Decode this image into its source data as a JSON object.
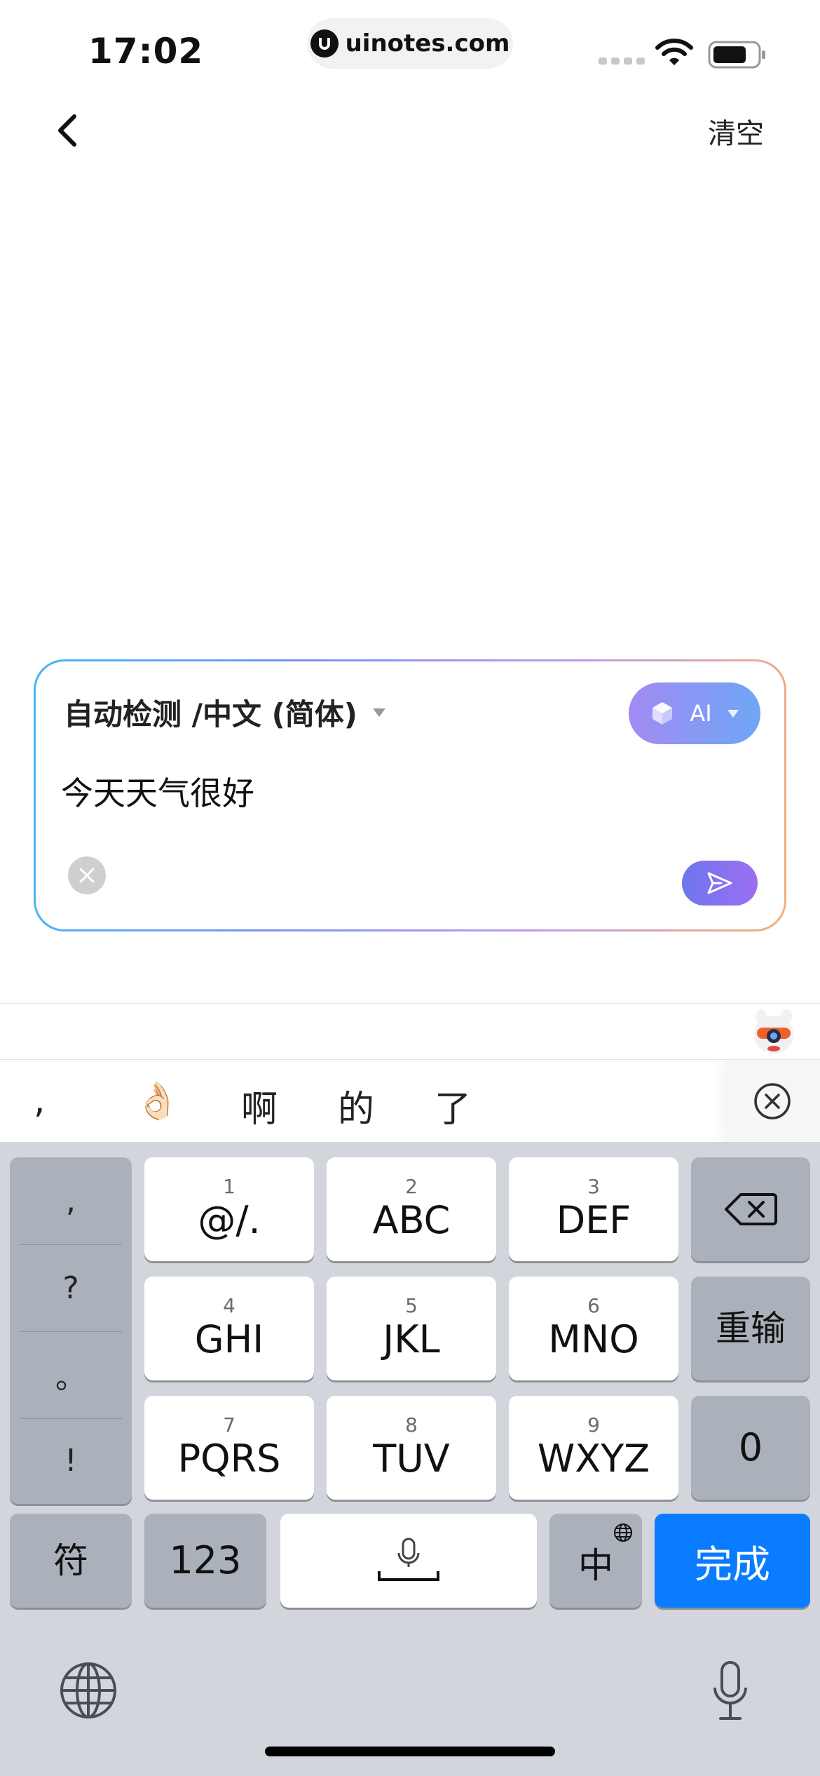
{
  "status_bar": {
    "time": "17:02",
    "url": "uinotes.com"
  },
  "header": {
    "clear_label": "清空"
  },
  "translator": {
    "language_label": "自动检测 /中文 (简体)",
    "ai_label": "AI",
    "input_text": "今天天气很好"
  },
  "candidates": [
    ",",
    "👌🏻",
    "啊",
    "的",
    "了"
  ],
  "keyboard": {
    "punctuation": [
      ",",
      "?",
      "。",
      "!"
    ],
    "keys": [
      {
        "digit": "1",
        "label": "@/."
      },
      {
        "digit": "2",
        "label": "ABC"
      },
      {
        "digit": "3",
        "label": "DEF"
      },
      {
        "digit": "4",
        "label": "GHI"
      },
      {
        "digit": "5",
        "label": "JKL"
      },
      {
        "digit": "6",
        "label": "MNO"
      },
      {
        "digit": "7",
        "label": "PQRS"
      },
      {
        "digit": "8",
        "label": "TUV"
      },
      {
        "digit": "9",
        "label": "WXYZ"
      }
    ],
    "reenter_label": "重输",
    "zero_label": "0",
    "symbols_label": "符",
    "numbers_label": "123",
    "lang_label": "中",
    "done_label": "完成"
  },
  "colors": {
    "accent_blue": "#0a7cff",
    "ai_gradient_start": "#a28af2",
    "ai_gradient_end": "#6fa6f6",
    "keyboard_bg": "#d2d5db"
  }
}
